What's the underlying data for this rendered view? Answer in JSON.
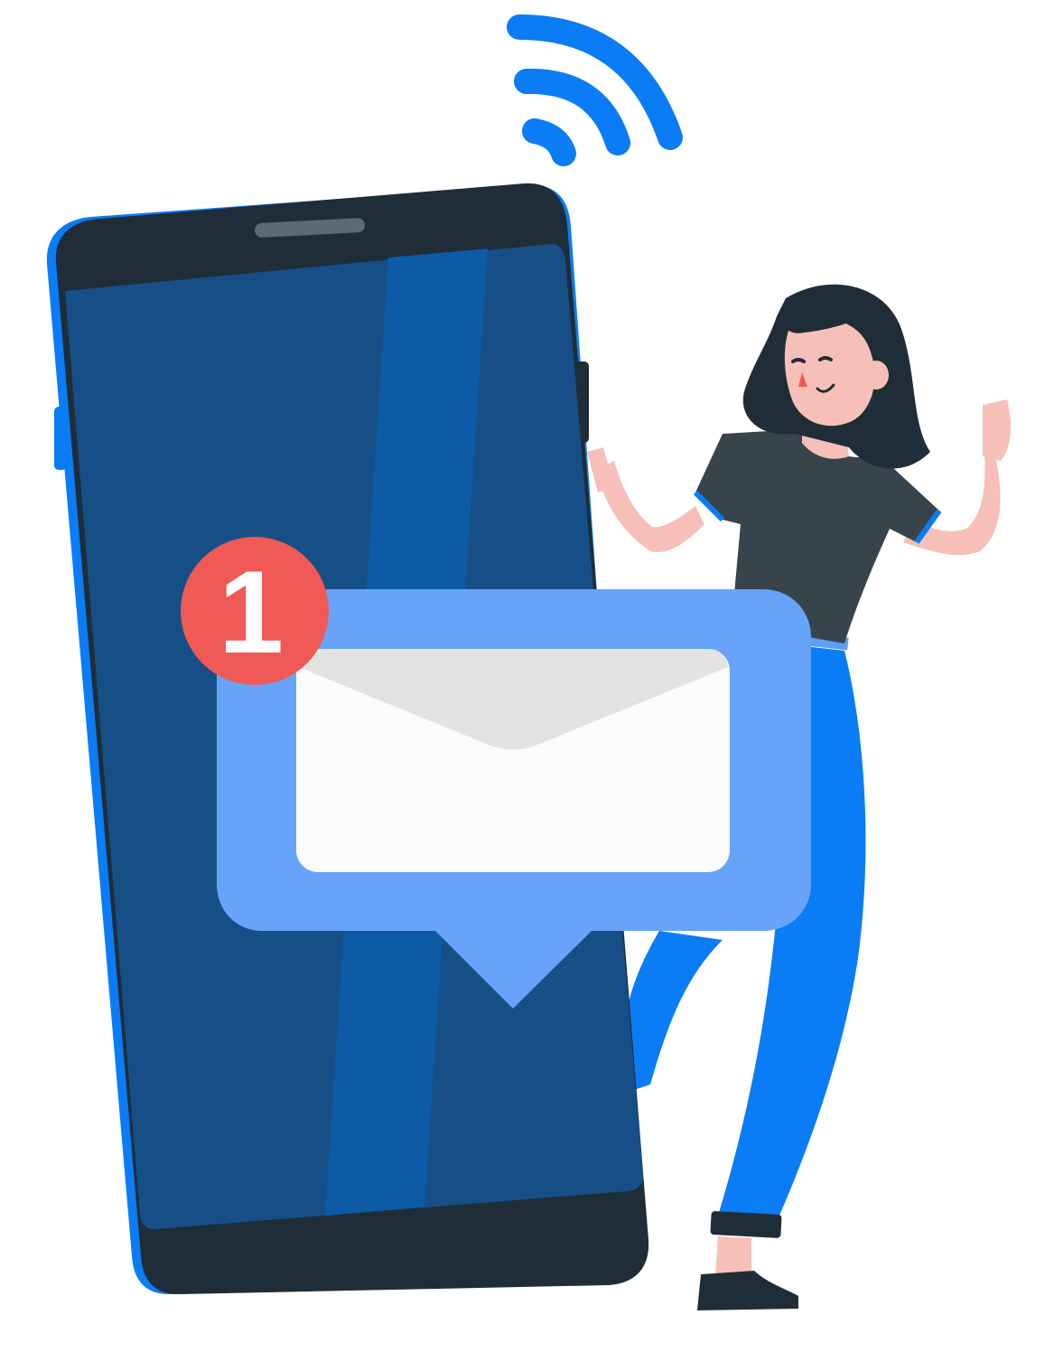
{
  "notification": {
    "badge_count": "1"
  },
  "colors": {
    "background": "#ffffff",
    "phone_body": "#1f2d38",
    "phone_edge": "#0a7cf5",
    "phone_screen": "#154f86",
    "phone_screen_stripe": "#0d5ba6",
    "speaker": "#5b6a74",
    "bubble": "#67a4f9",
    "envelope": "#fbfbfb",
    "envelope_flap": "#e3e3e3",
    "badge": "#f05955",
    "badge_text": "#ffffff",
    "wifi": "#0a7cf5",
    "hair": "#1f2d38",
    "skin": "#f6c0b8",
    "shirt": "#37444b",
    "jeans": "#0a7cf5",
    "shoe": "#1f2d38"
  },
  "icons": {
    "signal": "wifi-signal-icon",
    "message": "envelope-icon",
    "notification": "notification-badge-icon",
    "device": "smartphone-icon",
    "person": "woman-illustration"
  }
}
